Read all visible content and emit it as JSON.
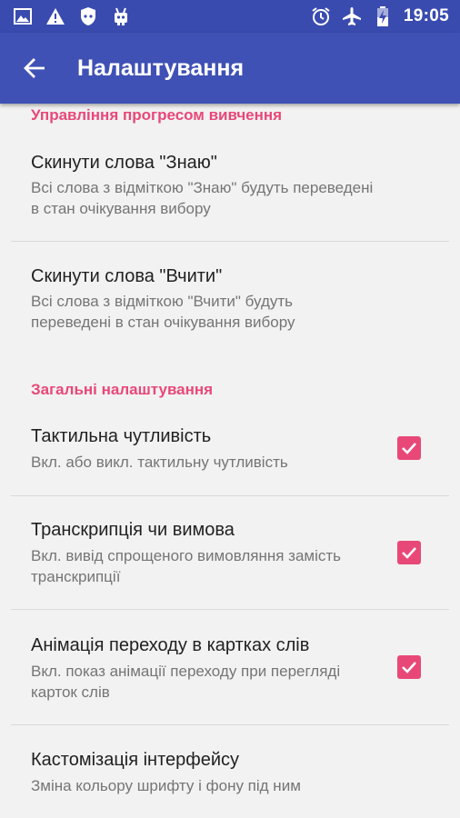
{
  "status_bar": {
    "time": "19:05",
    "left_icons": [
      "image-icon",
      "warning-icon",
      "shield-icon",
      "robot-icon"
    ],
    "right_icons": [
      "alarm-icon",
      "airplane-icon",
      "battery-charging-icon"
    ]
  },
  "app_bar": {
    "title": "Налаштування",
    "back_icon": "arrow-back-icon"
  },
  "sections": [
    {
      "header": "Управління прогресом вивчення",
      "items": [
        {
          "title": "Скинути слова \"Знаю\"",
          "summary": "Всі слова з відміткою \"Знаю\" будуть переведені в стан очікування вибору"
        },
        {
          "title": "Скинути слова \"Вчити\"",
          "summary": "Всі слова з відміткою \"Вчити\" будуть переведені в стан очікування вибору"
        }
      ]
    },
    {
      "header": "Загальні налаштування",
      "items": [
        {
          "title": "Тактильна чутливість",
          "summary": "Вкл. або викл. тактильну чутливість",
          "checked": true
        },
        {
          "title": "Транскрипція чи вимова",
          "summary": "Вкл. вивід спрощеного вимовляння замість транскрипції",
          "checked": true
        },
        {
          "title": "Анімація переходу в картках слів",
          "summary": "Вкл. показ анімації переходу при перегляді карток слів",
          "checked": true
        },
        {
          "title": "Кастомізація інтерфейсу",
          "summary": "Зміна кольору шрифту і фону під ним"
        }
      ]
    }
  ],
  "colors": {
    "status_bar": "#3a4bb0",
    "app_bar": "#3f51b5",
    "accent": "#e84878",
    "background": "#f2f2f2"
  }
}
